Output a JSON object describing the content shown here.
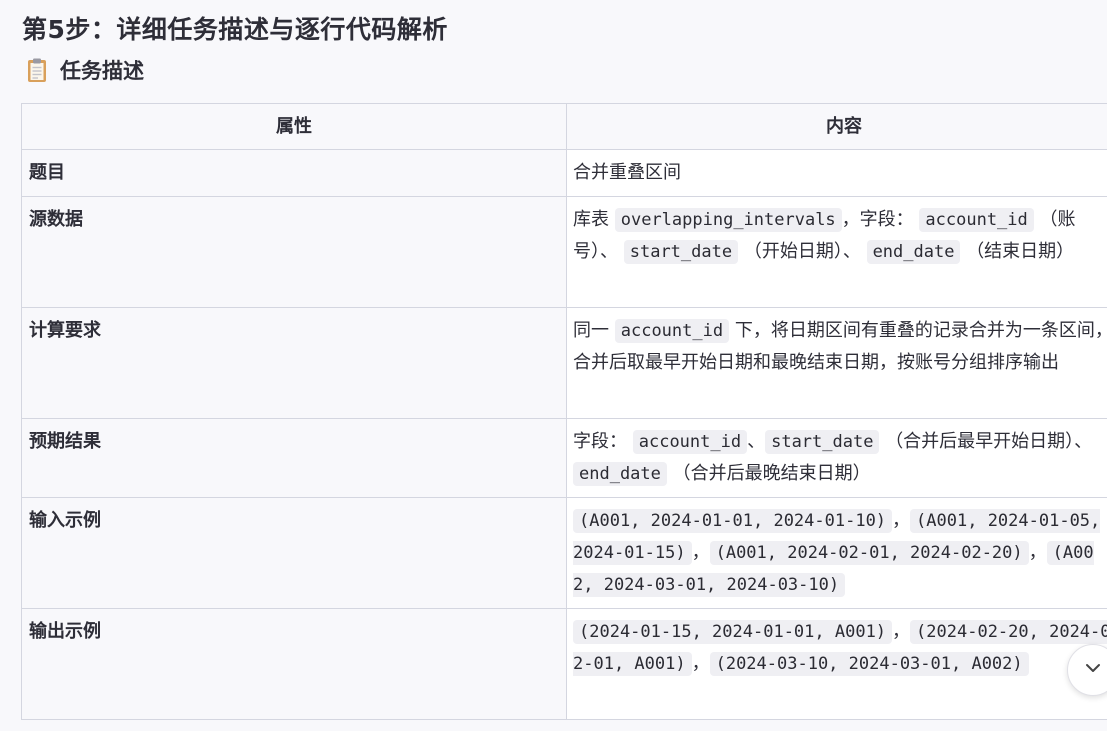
{
  "heading": {
    "step": "第5步：详细任务描述与逐行代码解析",
    "section": "任务描述"
  },
  "icons": {
    "section_icon": "clipboard-icon",
    "scroll_button": "chevron-down-icon"
  },
  "table": {
    "headers": [
      "属性",
      "内容"
    ],
    "rows": [
      {
        "key": "题目",
        "value": [
          "合并重叠区间"
        ]
      },
      {
        "key": "源数据",
        "value": [
          "库表",
          "overlapping_intervals",
          "，字段：",
          "account_id",
          "（账号）、",
          "start_date",
          "（开始日期）、",
          "end_date",
          "（结束日期）"
        ]
      },
      {
        "key": "计算要求",
        "value": [
          "同一",
          "account_id",
          "下，将日期区间有重叠的记录合并为一条区间，合并后取最早开始日期和最晚结束日期，按账号分组排序输出"
        ]
      },
      {
        "key": "预期结果",
        "value": [
          "字段：",
          "account_id",
          "、",
          "start_date",
          "（合并后最早开始日期）、",
          "end_date",
          "（合并后最晚结束日期）"
        ]
      },
      {
        "key": "输入示例",
        "value": [
          "(A001, 2024-01-01, 2024-01-10)",
          "，",
          "(A001, 2024-01-05, 2024-01-15)",
          "，",
          "(A001, 2024-02-01, 2024-02-20)",
          "，",
          "(A002, 2024-03-01, 2024-03-10)"
        ]
      },
      {
        "key": "输出示例",
        "value": [
          "(2024-01-15, 2024-01-01, A001)",
          "，",
          "(2024-02-20, 2024-02-01, A001)",
          "，",
          "(2024-03-10, 2024-03-01, A002)"
        ]
      }
    ]
  }
}
